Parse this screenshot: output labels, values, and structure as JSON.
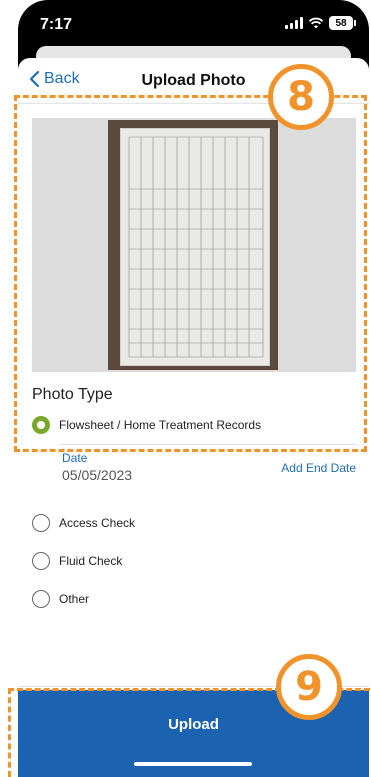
{
  "status_bar": {
    "time": "7:17",
    "battery": "58"
  },
  "nav": {
    "back_label": "Back",
    "title": "Upload Photo"
  },
  "photo_type": {
    "title": "Photo Type",
    "options": [
      {
        "label": "Flowsheet / Home Treatment Records",
        "selected": true
      },
      {
        "label": "Access Check",
        "selected": false
      },
      {
        "label": "Fluid Check",
        "selected": false
      },
      {
        "label": "Other",
        "selected": false
      }
    ]
  },
  "date": {
    "label": "Date",
    "value": "05/05/2023",
    "add_end_date": "Add End Date"
  },
  "upload": {
    "label": "Upload"
  },
  "annotations": {
    "badge_1": "8",
    "badge_2": "9"
  },
  "colors": {
    "accent_blue": "#1b63b1",
    "selected_green": "#79a82c",
    "annotation_orange": "#f0932b"
  }
}
